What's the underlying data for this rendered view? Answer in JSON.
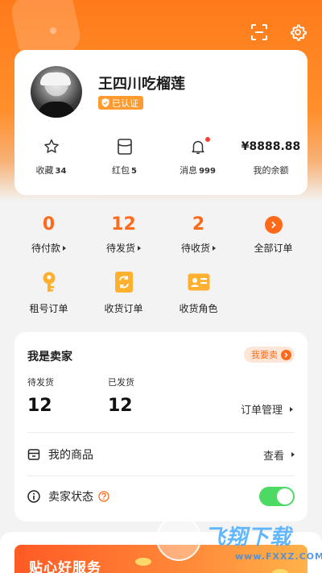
{
  "colors": {
    "accent": "#ff6a1a",
    "header_gradient_top": "#ff7a1a",
    "verified_badge": "#ff9a2e",
    "toggle_on": "#4cd964",
    "notification_dot": "#ff3b30"
  },
  "header": {
    "icons": [
      "scan-icon",
      "settings-icon"
    ]
  },
  "profile": {
    "name": "王四川吃榴莲",
    "verified_label": "已认证",
    "stats": [
      {
        "icon": "star-icon",
        "label": "收藏",
        "count": "34"
      },
      {
        "icon": "wallet-icon",
        "label": "红包",
        "count": "5"
      },
      {
        "icon": "bell-icon",
        "label": "消息",
        "count": "999",
        "has_dot": true
      },
      {
        "balance": "¥8888.88",
        "label": "我的余额"
      }
    ]
  },
  "orders": [
    {
      "count": "0",
      "label": "待付款"
    },
    {
      "count": "12",
      "label": "待发货"
    },
    {
      "count": "2",
      "label": "待收货"
    },
    {
      "label": "全部订单",
      "icon": "arrow-right-circle-icon"
    }
  ],
  "tools": [
    {
      "label": "租号订单",
      "icon": "key-icon"
    },
    {
      "label": "收货订单",
      "icon": "refresh-doc-icon"
    },
    {
      "label": "收货角色",
      "icon": "id-card-icon"
    }
  ],
  "seller": {
    "title": "我是卖家",
    "sell_button": "我要卖",
    "pending_label": "待发货",
    "pending_count": "12",
    "shipped_label": "已发货",
    "shipped_count": "12",
    "manage_label": "订单管理",
    "my_goods_label": "我的商品",
    "view_label": "查看",
    "status_label": "卖家状态",
    "status_on": true
  },
  "banner": {
    "text": "贴心好服务"
  },
  "watermark": {
    "text": "飞翔下载",
    "url": "www.FXXZ.COM"
  }
}
